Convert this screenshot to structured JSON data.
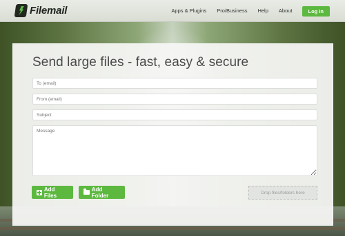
{
  "header": {
    "logo_text": "Filemail",
    "nav": [
      "Apps & Plugins",
      "Pro/Business",
      "Help",
      "About"
    ],
    "login_label": "Log in"
  },
  "main": {
    "title": "Send large files - fast, easy & secure",
    "to_placeholder": "To (email)",
    "from_placeholder": "From (email)",
    "subject_placeholder": "Subject",
    "message_placeholder": "Message",
    "add_files_label": "Add Files",
    "add_folder_label": "Add Folder",
    "drop_label": "Drop files/folders here"
  },
  "colors": {
    "accent": "#5cb83f",
    "header_bg": "#e3e7df"
  }
}
